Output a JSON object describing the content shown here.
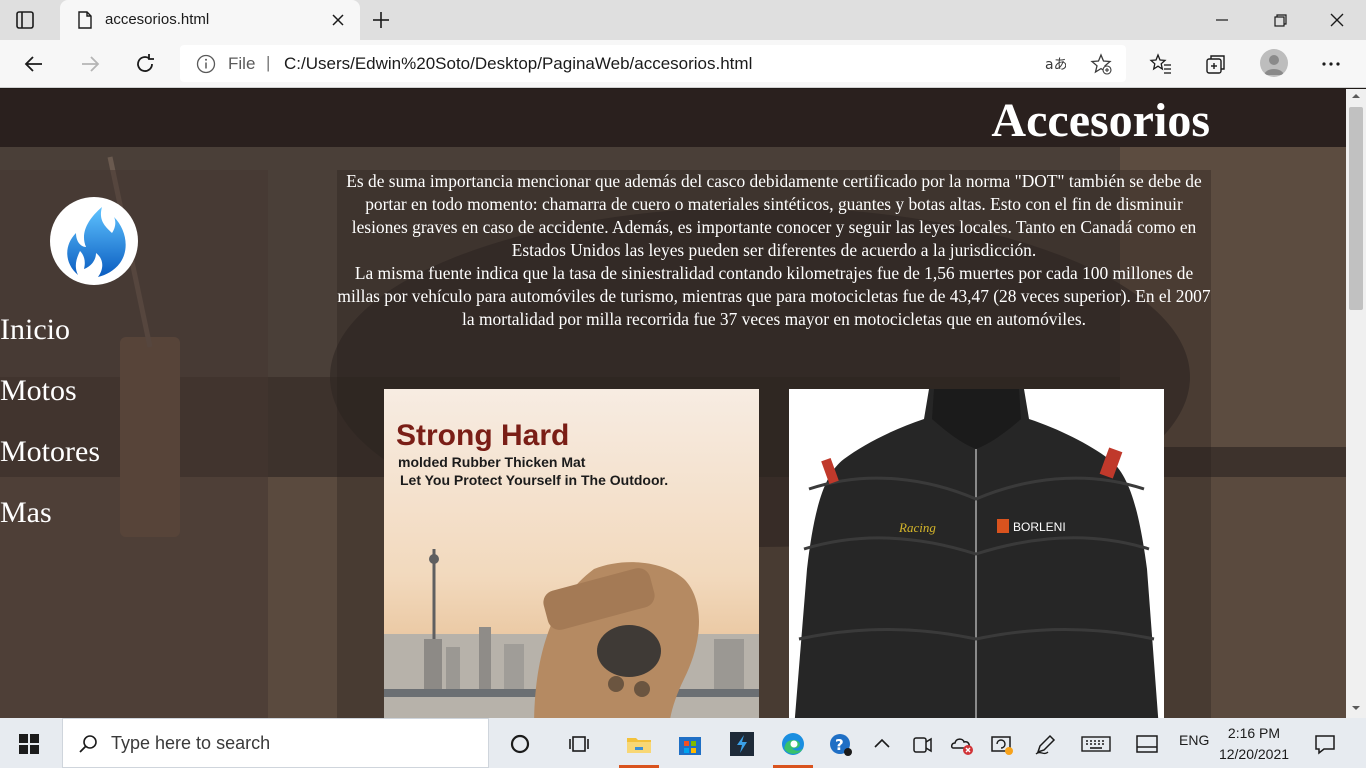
{
  "browser": {
    "tab_title": "accesorios.html",
    "address_scheme": "File",
    "address_url": "C:/Users/Edwin%20Soto/Desktop/PaginaWeb/accesorios.html"
  },
  "page": {
    "title": "Accesorios",
    "nav": [
      "Inicio",
      "Motos",
      "Motores",
      "Mas"
    ],
    "paragraph1": "Es de suma importancia mencionar que además del casco debidamente certificado por la norma \"DOT\" también se debe de portar en todo momento: chamarra de cuero o materiales sintéticos, guantes y botas altas. Esto con el fin de disminuir lesiones graves en caso de accidente. Además, es importante conocer y seguir las leyes locales. Tanto en Canadá como en Estados Unidos las leyes pueden ser diferentes de acuerdo a la jurisdicción.",
    "paragraph2": "La misma fuente indica que la tasa de siniestralidad contando kilometrajes fue de 1,56 muertes por cada 100 millones de millas por vehículo para automóviles de turismo, mientras que para motocicletas fue de 43,47 (28 veces superior). En el 2007 la mortalidad por milla recorrida fue 37 veces mayor en motocicletas que en automóviles.",
    "gloves_ad": {
      "headline": "Strong Hard",
      "line1": "molded Rubber Thicken Mat",
      "line2": "Let You Protect Yourself in The Outdoor."
    },
    "jacket_labels": {
      "chest_left": "Racing",
      "chest_right": "BORLENI"
    }
  },
  "taskbar": {
    "search_placeholder": "Type here to search",
    "language": "ENG",
    "time": "2:16 PM",
    "date": "12/20/2021"
  }
}
